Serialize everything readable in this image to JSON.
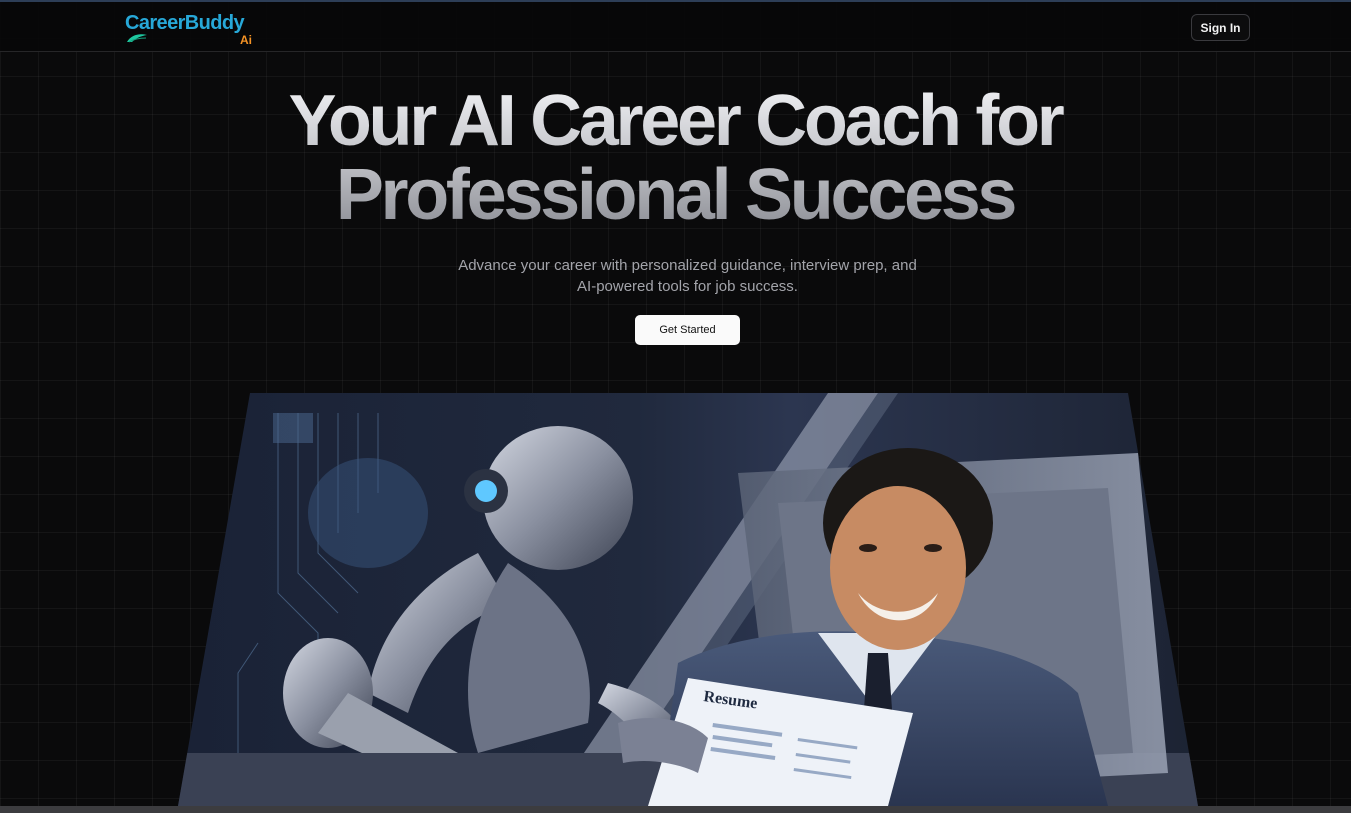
{
  "navbar": {
    "logo": {
      "word": "CareerBuddy",
      "suffix": "Ai",
      "word_color": "#27a8d8",
      "suffix_color": "#f59325",
      "leaf_color": "#1ec8a0",
      "icon": "leaf-swoosh-icon"
    },
    "signin_label": "Sign In"
  },
  "hero": {
    "title_line1": "Your AI Career Coach for",
    "title_line2": "Professional Success",
    "subtitle": "Advance your career with personalized guidance, interview prep, and AI-powered tools for job success.",
    "cta_label": "Get Started"
  },
  "image": {
    "alt": "Robot and smiling man in suit reviewing a resume",
    "resume_heading": "Resume"
  },
  "colors": {
    "background": "#0a0a0b",
    "accent": "#27a8d8",
    "button_bg": "#fafafa"
  }
}
